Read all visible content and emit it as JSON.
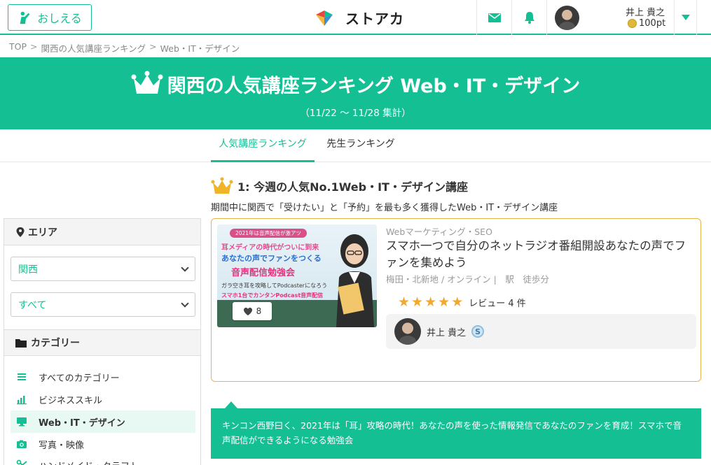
{
  "header": {
    "teach_label": "おしえる",
    "logo_text": "ストアカ",
    "user_name": "井上 貴之",
    "user_points": "100pt"
  },
  "breadcrumb": [
    "TOP",
    "関西の人気講座ランキング",
    "Web・IT・デザイン"
  ],
  "breadcrumb_sep": ">",
  "hero": {
    "title": "関西の人気講座ランキング Web・IT・デザイン",
    "period": "（11/22 〜 11/28 集計）"
  },
  "tabs": [
    {
      "label": "人気講座ランキング",
      "active": true
    },
    {
      "label": "先生ランキング",
      "active": false
    }
  ],
  "sidebar": {
    "area_heading": "エリア",
    "region_select": "関西",
    "sub_select": "すべて",
    "category_heading": "カテゴリー",
    "categories": [
      {
        "label": "すべてのカテゴリー",
        "icon": "list-icon",
        "active": false
      },
      {
        "label": "ビジネススキル",
        "icon": "bar-chart-icon",
        "active": false
      },
      {
        "label": "Web・IT・デザイン",
        "icon": "monitor-icon",
        "active": true
      },
      {
        "label": "写真・映像",
        "icon": "camera-icon",
        "active": false
      },
      {
        "label": "ハンドメイド・クラフト",
        "icon": "scissors-icon",
        "active": false
      }
    ]
  },
  "ranking": {
    "title": "1: 今週の人気No.1Web・IT・デザイン講座",
    "description": "期間中に関西で「受けたい」と「予約」を最も多く獲得したWeb・IT・デザイン講座"
  },
  "course": {
    "thumb_lines": [
      "2021年は音声配信が激アツ",
      "耳メディアの時代がついに到来",
      "あなたの声でファンをつくる",
      "音声配信勉強会",
      "ガラ空き耳を攻略してPodcasterになろう",
      "スマホ1台でカンタンPodcast音声配信"
    ],
    "likes": "8",
    "category": "Webマーケティング・SEO",
    "title": "スマホ一つで自分のネットラジオ番組開設あなたの声でファンを集めよう",
    "location": "梅田・北新地 / オンライン |　駅　徒歩分",
    "rating": 5,
    "review_text": "レビュー 4 件",
    "teacher_name": "井上 貴之",
    "teacher_badge": "S"
  },
  "course_summary": "キンコン西野曰く、2021年は「耳」攻略の時代！あなたの声を使った情報発信であなたのファンを育成！スマホで音声配信ができるようになる勉強会",
  "colors": {
    "brand": "#14bf94",
    "card_border": "#e4b64a",
    "star": "#f0a92e"
  }
}
